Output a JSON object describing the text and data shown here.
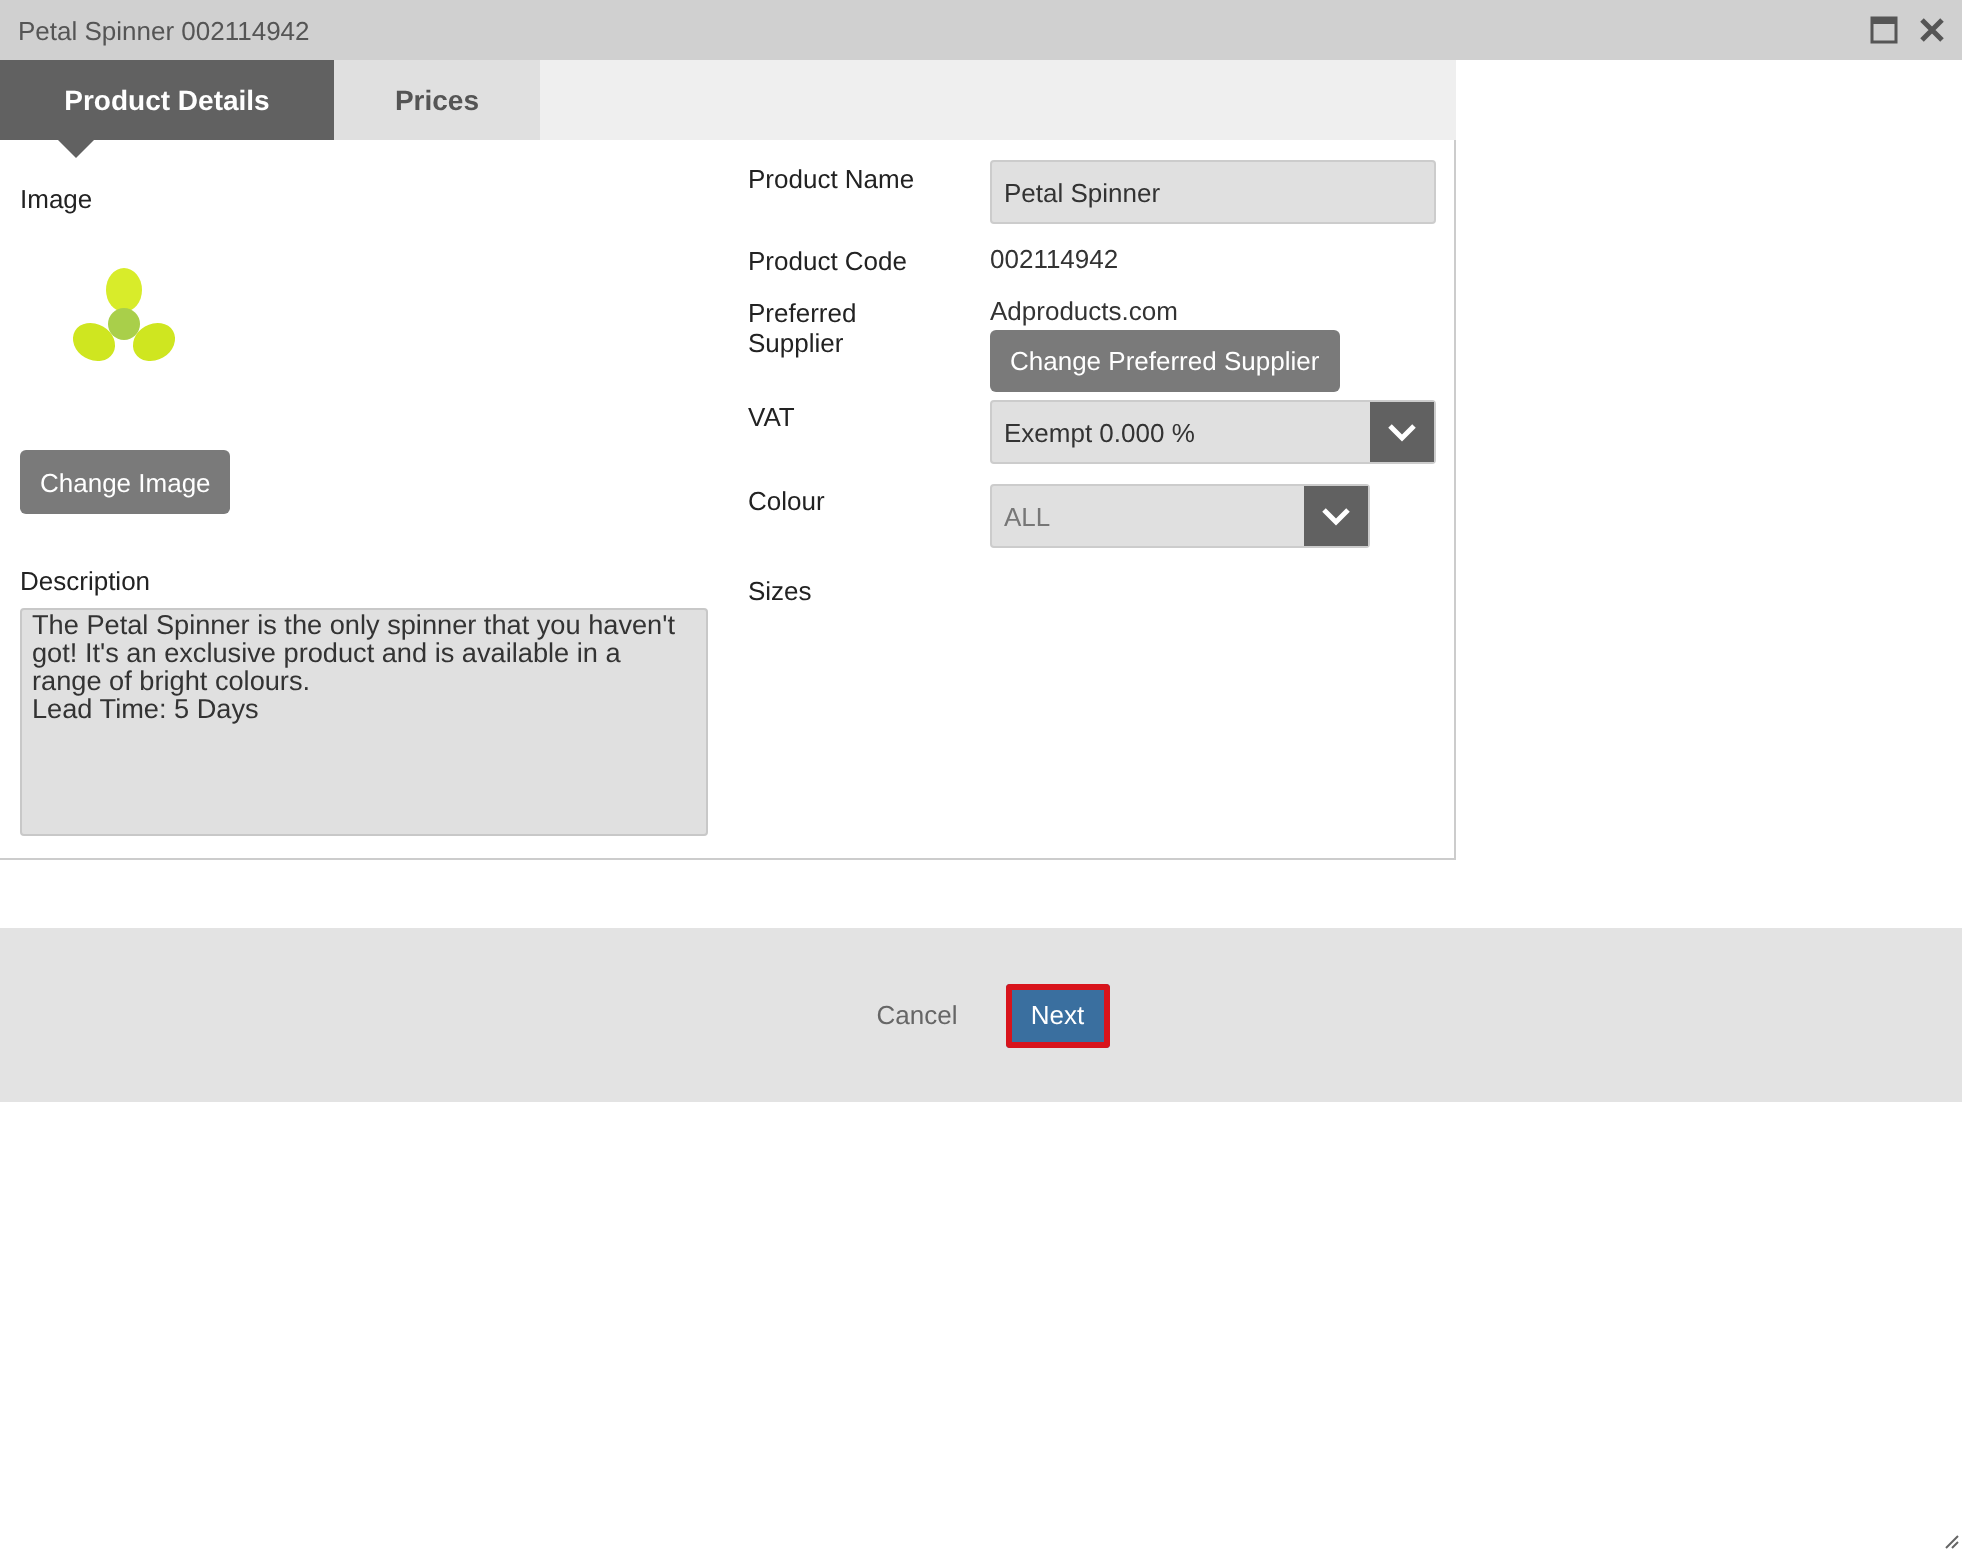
{
  "window": {
    "title": "Petal Spinner 002114942"
  },
  "tabs": [
    {
      "label": "Product Details",
      "selected": true
    },
    {
      "label": "Prices",
      "selected": false
    }
  ],
  "image_section": {
    "label": "Image",
    "button": "Change Image"
  },
  "description": {
    "label": "Description",
    "value": "The Petal Spinner is the only spinner that you haven't got! It's an exclusive product and is available in a range of bright colours.\nLead Time: 5 Days"
  },
  "fields": [
    {
      "kind": "input",
      "label": "Product Name",
      "value": "Petal Spinner"
    },
    {
      "kind": "text",
      "label": "Product Code",
      "value": "002114942"
    },
    {
      "kind": "supplier",
      "label": "Preferred Supplier",
      "value": "Adproducts.com",
      "button": "Change Preferred Supplier"
    },
    {
      "kind": "select",
      "label": "VAT",
      "value": "Exempt 0.000 %",
      "disabled": false
    },
    {
      "kind": "select",
      "label": "Colour",
      "value": "ALL",
      "disabled": true
    },
    {
      "kind": "empty",
      "label": "Sizes"
    }
  ],
  "footer": {
    "cancel": "Cancel",
    "next": "Next",
    "next_focused": true
  }
}
